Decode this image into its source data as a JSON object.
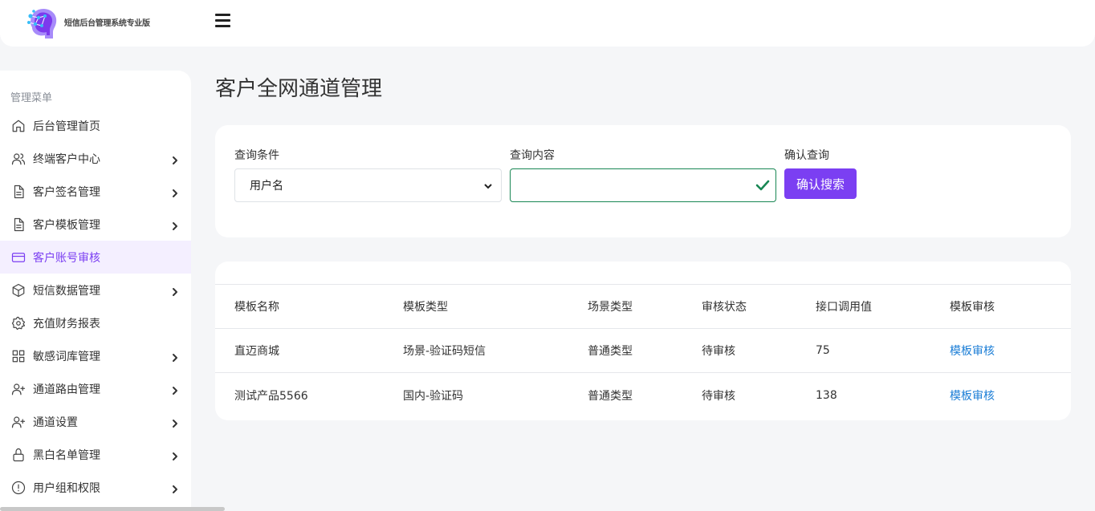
{
  "header": {
    "brand": "短信后台管理系统专业版"
  },
  "sidebar": {
    "title": "管理菜单",
    "items": [
      {
        "label": "后台管理首页",
        "icon": "home-icon",
        "chevron": false
      },
      {
        "label": "终端客户中心",
        "icon": "users-icon",
        "chevron": true
      },
      {
        "label": "客户签名管理",
        "icon": "file-text-icon",
        "chevron": true
      },
      {
        "label": "客户模板管理",
        "icon": "file-text-icon",
        "chevron": true
      },
      {
        "label": "客户账号审核",
        "icon": "credit-card-icon",
        "chevron": false,
        "active": true
      },
      {
        "label": "短信数据管理",
        "icon": "box-icon",
        "chevron": true
      },
      {
        "label": "充值财务报表",
        "icon": "settings-icon",
        "chevron": false
      },
      {
        "label": "敏感词库管理",
        "icon": "grid-icon",
        "chevron": true
      },
      {
        "label": "通道路由管理",
        "icon": "user-plus-icon",
        "chevron": true
      },
      {
        "label": "通道设置",
        "icon": "user-plus-icon",
        "chevron": true
      },
      {
        "label": "黑白名单管理",
        "icon": "lock-icon",
        "chevron": true
      },
      {
        "label": "用户组和权限",
        "icon": "alert-circle-icon",
        "chevron": true
      }
    ]
  },
  "page": {
    "title": "客户全网通道管理"
  },
  "search": {
    "condition_label": "查询条件",
    "condition_value": "用户名",
    "content_label": "查询内容",
    "content_value": "",
    "confirm_label": "确认查询",
    "button_label": "确认搜索"
  },
  "table": {
    "headers": [
      "模板名称",
      "模板类型",
      "场景类型",
      "审核状态",
      "接口调用值",
      "模板审核"
    ],
    "rows": [
      [
        "直迈商城",
        "场景-验证码短信",
        "普通类型",
        "待审核",
        "75",
        "模板审核"
      ],
      [
        "测试产品5566",
        "国内-验证码",
        "普通类型",
        "待审核",
        "138",
        "模板审核"
      ]
    ]
  },
  "colors": {
    "accent": "#7b3ff2",
    "success": "#198754",
    "link": "#1c7ed6",
    "active_bg": "#f4efff"
  }
}
